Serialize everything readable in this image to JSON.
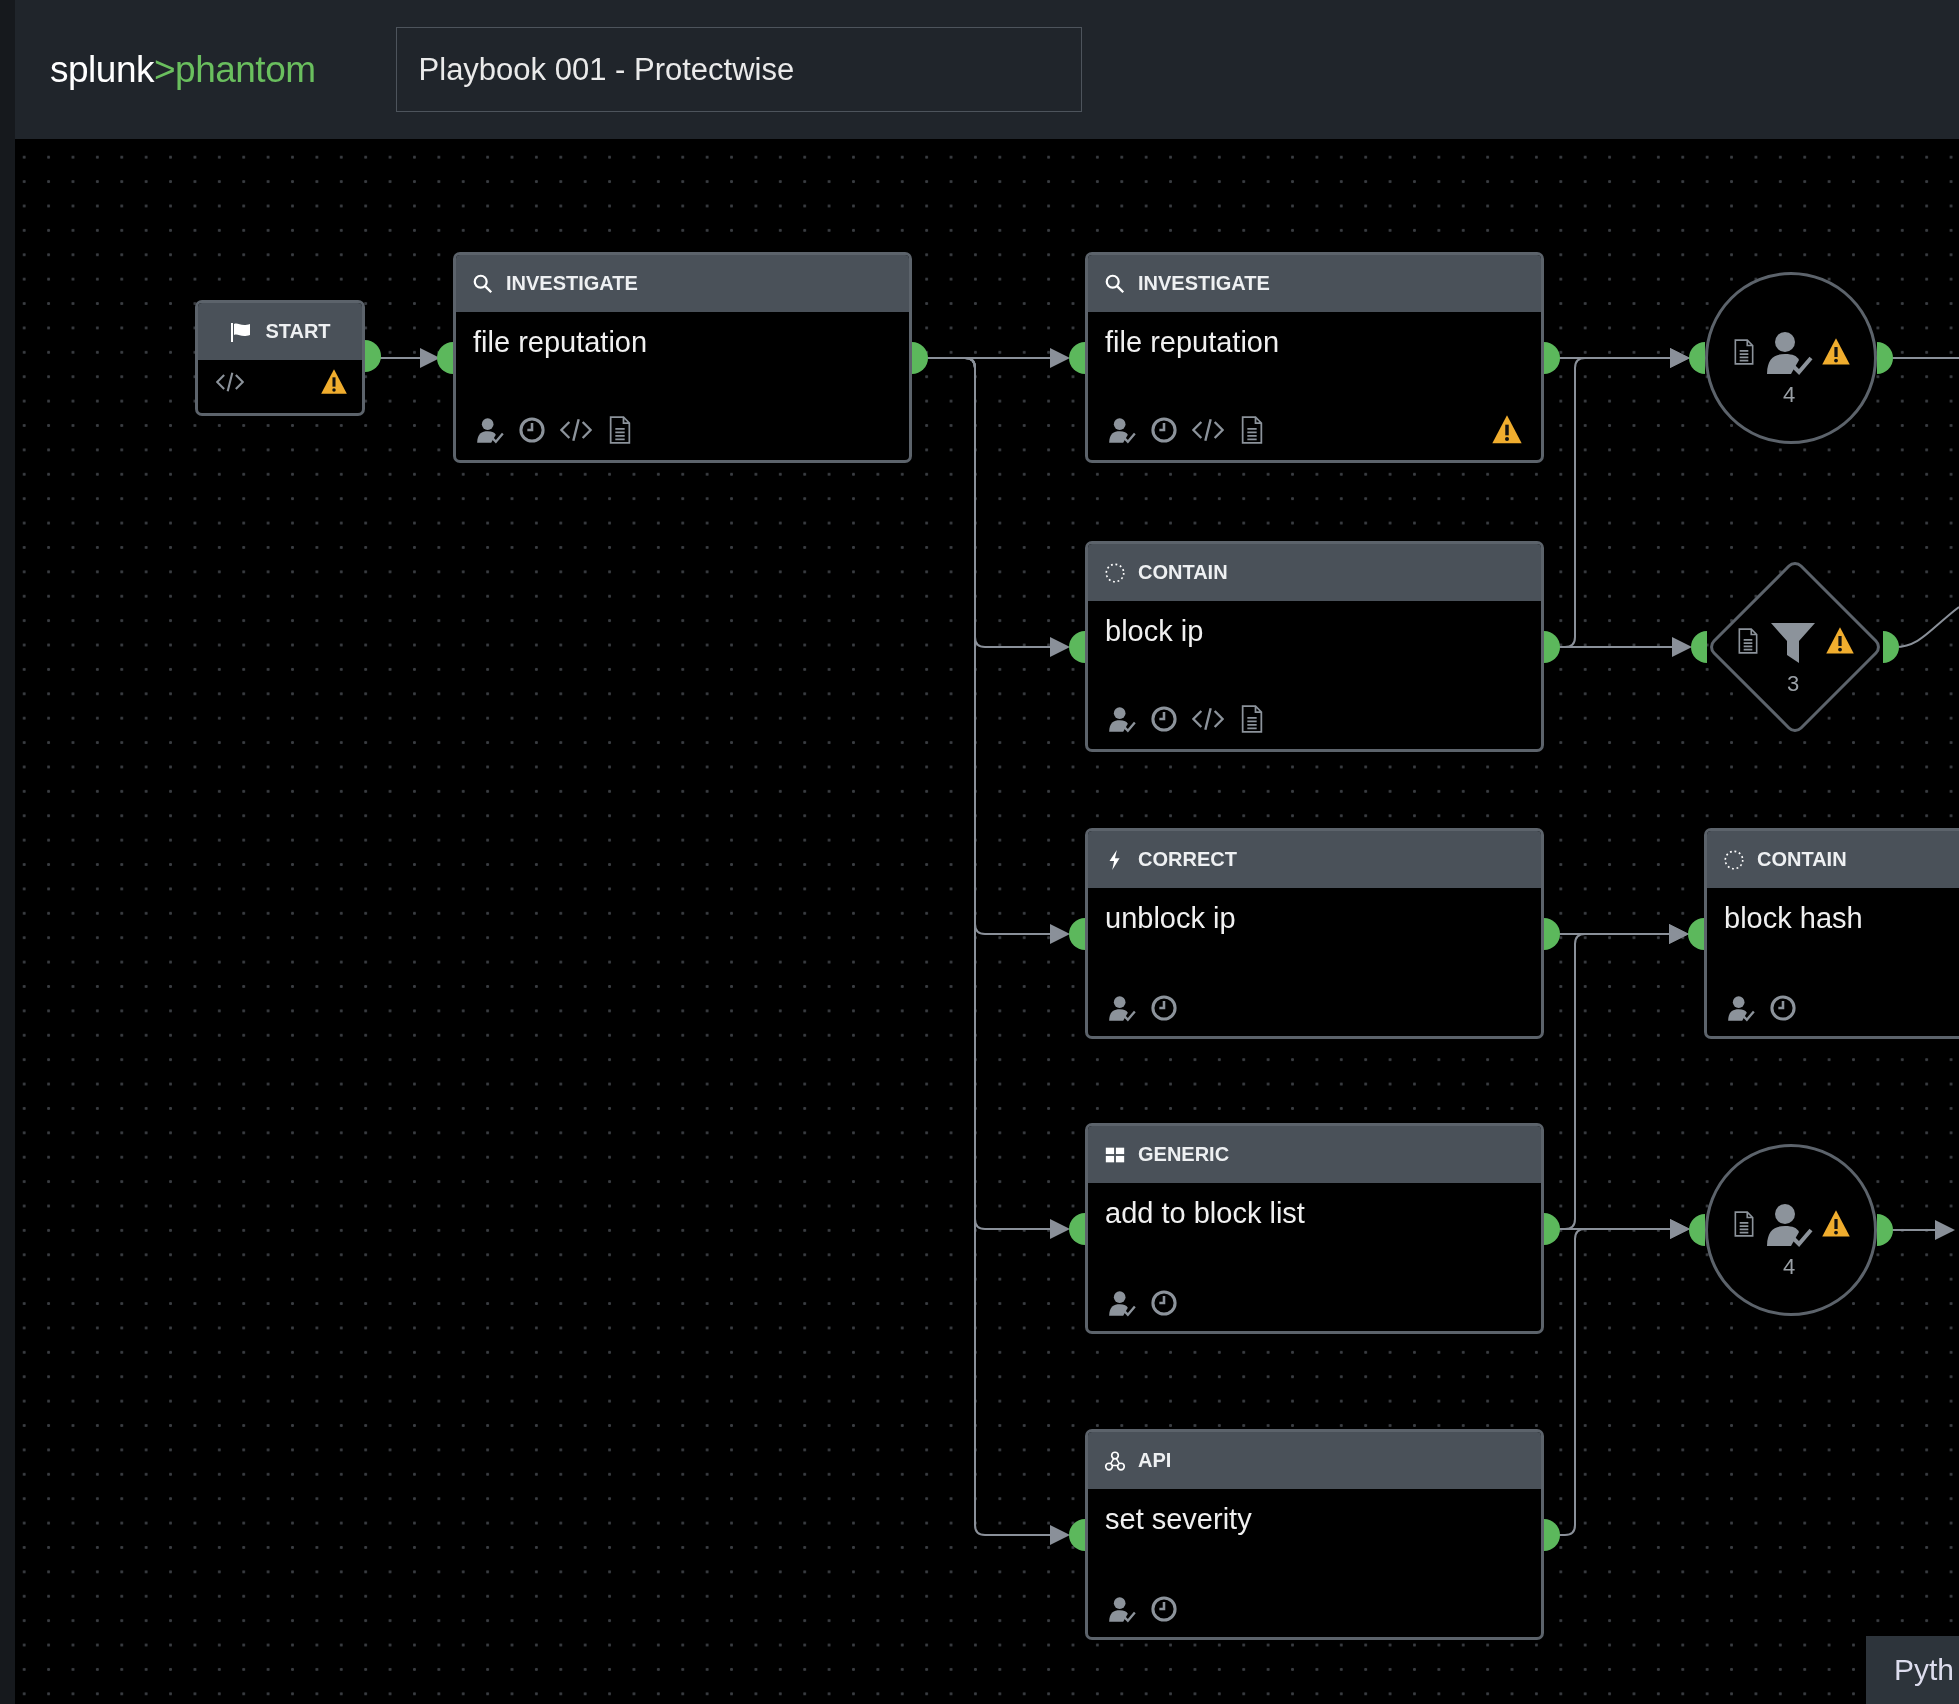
{
  "header": {
    "logo": {
      "brand": "splunk",
      "separator": ">",
      "product": "phantom"
    },
    "playbook_title": "Playbook 001 - Protectwise"
  },
  "nodes": [
    {
      "kind": "start",
      "title": "START",
      "code": true,
      "warning": true
    },
    {
      "kind": "investigate",
      "title": "INVESTIGATE",
      "name": "file reputation",
      "code": true,
      "notes": true,
      "warning": false
    },
    {
      "kind": "investigate",
      "title": "INVESTIGATE",
      "name": "file reputation",
      "code": true,
      "notes": true,
      "warning": true
    },
    {
      "kind": "contain",
      "title": "CONTAIN",
      "name": "block ip",
      "code": true,
      "notes": true,
      "warning": false
    },
    {
      "kind": "correct",
      "title": "CORRECT",
      "name": "unblock ip",
      "code": false,
      "notes": false,
      "warning": false
    },
    {
      "kind": "generic",
      "title": "GENERIC",
      "name": "add to block list",
      "code": false,
      "notes": false,
      "warning": false
    },
    {
      "kind": "api",
      "title": "API",
      "name": "set severity",
      "code": false,
      "notes": false,
      "warning": false
    },
    {
      "kind": "prompt",
      "count": "4",
      "notes": true,
      "warning": true
    },
    {
      "kind": "filter",
      "count": "3",
      "notes": true,
      "warning": true
    },
    {
      "kind": "contain",
      "title": "CONTAIN",
      "name": "block hash",
      "code": false,
      "notes": false,
      "warning": false
    },
    {
      "kind": "prompt",
      "count": "4",
      "notes": true,
      "warning": true
    }
  ],
  "language_button": "Pyth"
}
